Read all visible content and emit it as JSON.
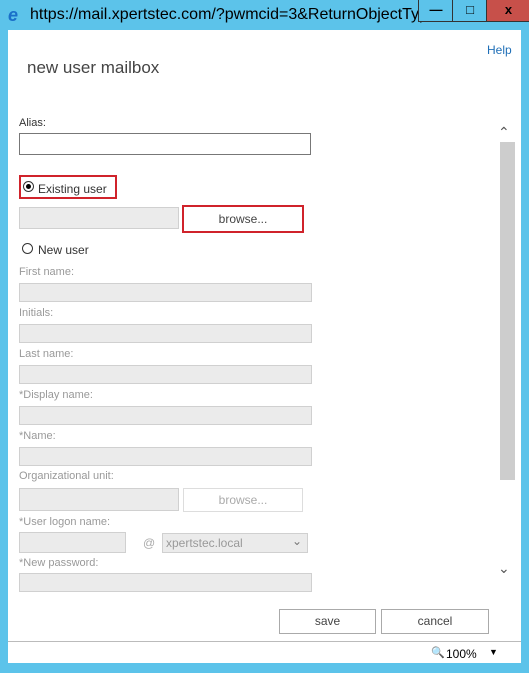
{
  "window": {
    "title": "https://mail.xpertstec.com/?pwmcid=3&ReturnObjectType...",
    "minimize": "—",
    "maximize": "□",
    "close": "x"
  },
  "dialog": {
    "title": "new user mailbox",
    "help": "Help"
  },
  "form": {
    "alias_label": "Alias:",
    "alias_value": "",
    "existing_user": "Existing user",
    "existing_selected": true,
    "browse": "browse...",
    "new_user": "New user",
    "first_name": "First name:",
    "initials": "Initials:",
    "last_name": "Last name:",
    "display_name": "*Display name:",
    "name": "*Name:",
    "org_unit": "Organizational unit:",
    "logon_name": "*User logon name:",
    "at": "@",
    "domain": "xpertstec.local",
    "new_password": "*New password:"
  },
  "actions": {
    "save": "save",
    "cancel": "cancel"
  },
  "status": {
    "zoom": "100%"
  },
  "colors": {
    "frame": "#5cc3ea",
    "highlight": "#d0232b",
    "close": "#c7504a"
  }
}
